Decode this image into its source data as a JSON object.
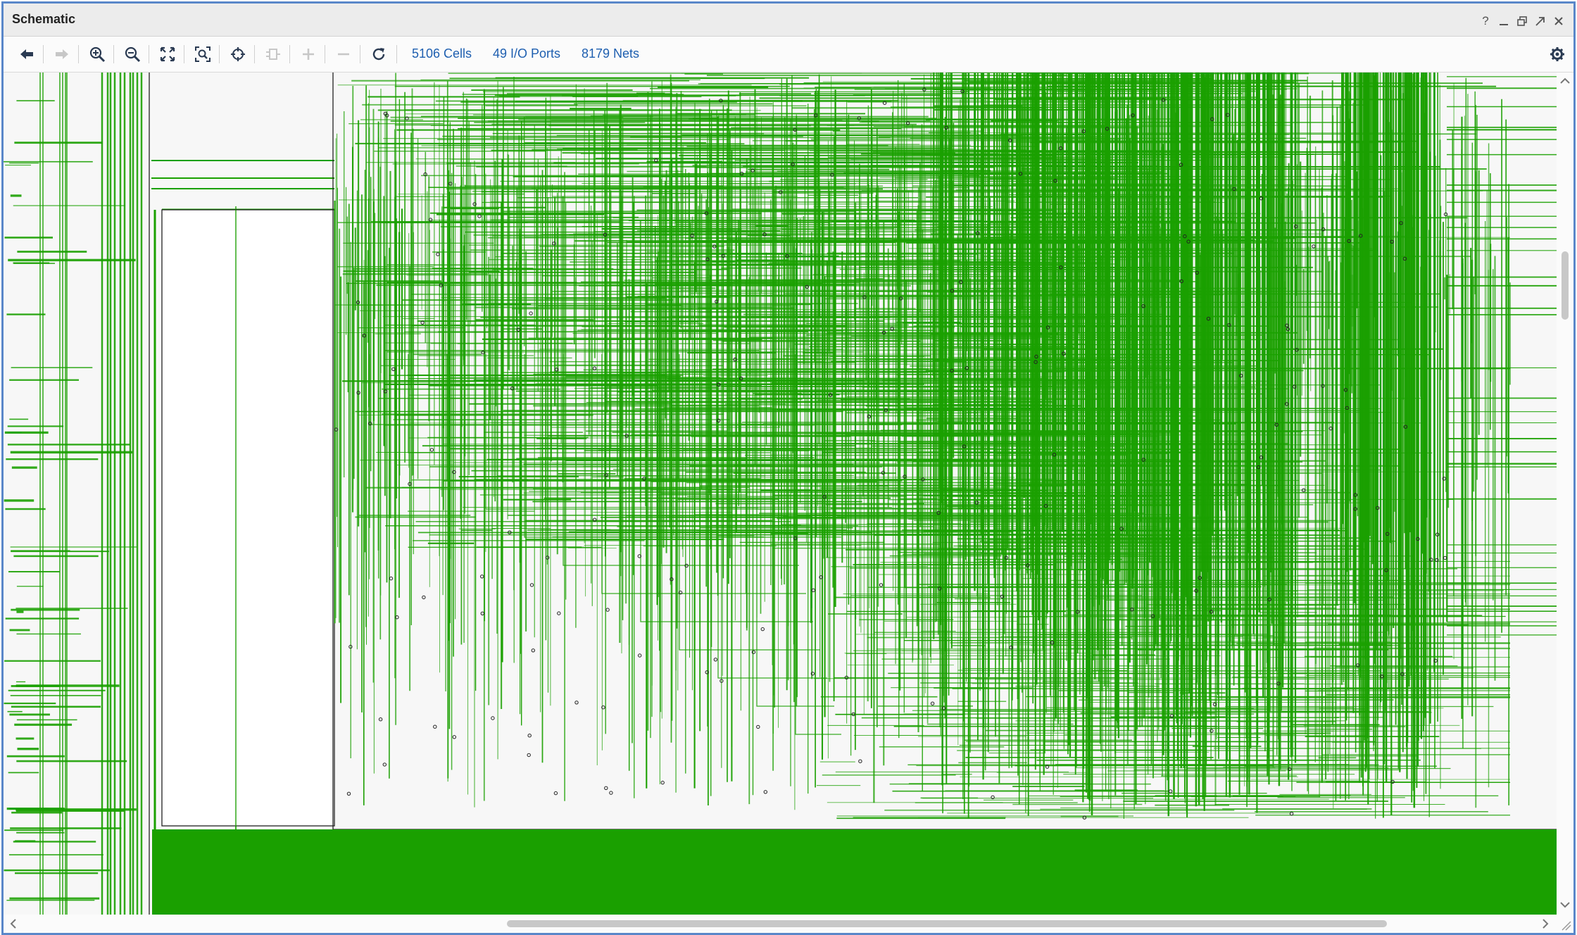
{
  "window": {
    "title": "Schematic"
  },
  "window_controls": [
    {
      "name": "help-button",
      "icon": "question-icon",
      "glyph": "?"
    },
    {
      "name": "minimize-button",
      "icon": "minimize-icon",
      "glyph": "—"
    },
    {
      "name": "restore-button",
      "icon": "restore-icon",
      "glyph": "❐"
    },
    {
      "name": "float-button",
      "icon": "float-icon",
      "glyph": "⇱"
    },
    {
      "name": "close-button",
      "icon": "close-icon",
      "glyph": "✕"
    }
  ],
  "toolbar": {
    "buttons": [
      {
        "name": "back-button",
        "icon": "arrow-left-icon",
        "enabled": true
      },
      {
        "name": "forward-button",
        "icon": "arrow-right-icon",
        "enabled": false
      },
      {
        "name": "zoom-in-button",
        "icon": "zoom-in-icon",
        "enabled": true
      },
      {
        "name": "zoom-out-button",
        "icon": "zoom-out-icon",
        "enabled": true
      },
      {
        "name": "zoom-fit-button",
        "icon": "expand-icon",
        "enabled": true
      },
      {
        "name": "zoom-area-button",
        "icon": "zoom-area-icon",
        "enabled": true
      },
      {
        "name": "select-button",
        "icon": "crosshair-icon",
        "enabled": true
      },
      {
        "name": "collapse-cell-button",
        "icon": "cell-icon",
        "enabled": false
      },
      {
        "name": "expand-button",
        "icon": "plus-icon",
        "enabled": false
      },
      {
        "name": "collapse-button",
        "icon": "minus-icon",
        "enabled": false
      },
      {
        "name": "refresh-button",
        "icon": "refresh-icon",
        "enabled": true
      }
    ],
    "stats": {
      "cells": "5106 Cells",
      "ports": "49 I/O Ports",
      "nets": "8179 Nets"
    },
    "settings_icon": "gear-icon"
  },
  "schematic": {
    "net_color": "#1aa000",
    "background": "#f7f7f7",
    "outline_color": "#222222"
  },
  "scrollbars": {
    "vertical": {
      "position_fraction": 0.2,
      "thumb_fraction": 0.085
    },
    "horizontal": {
      "position_fraction": 0.32,
      "thumb_fraction": 0.58
    }
  }
}
